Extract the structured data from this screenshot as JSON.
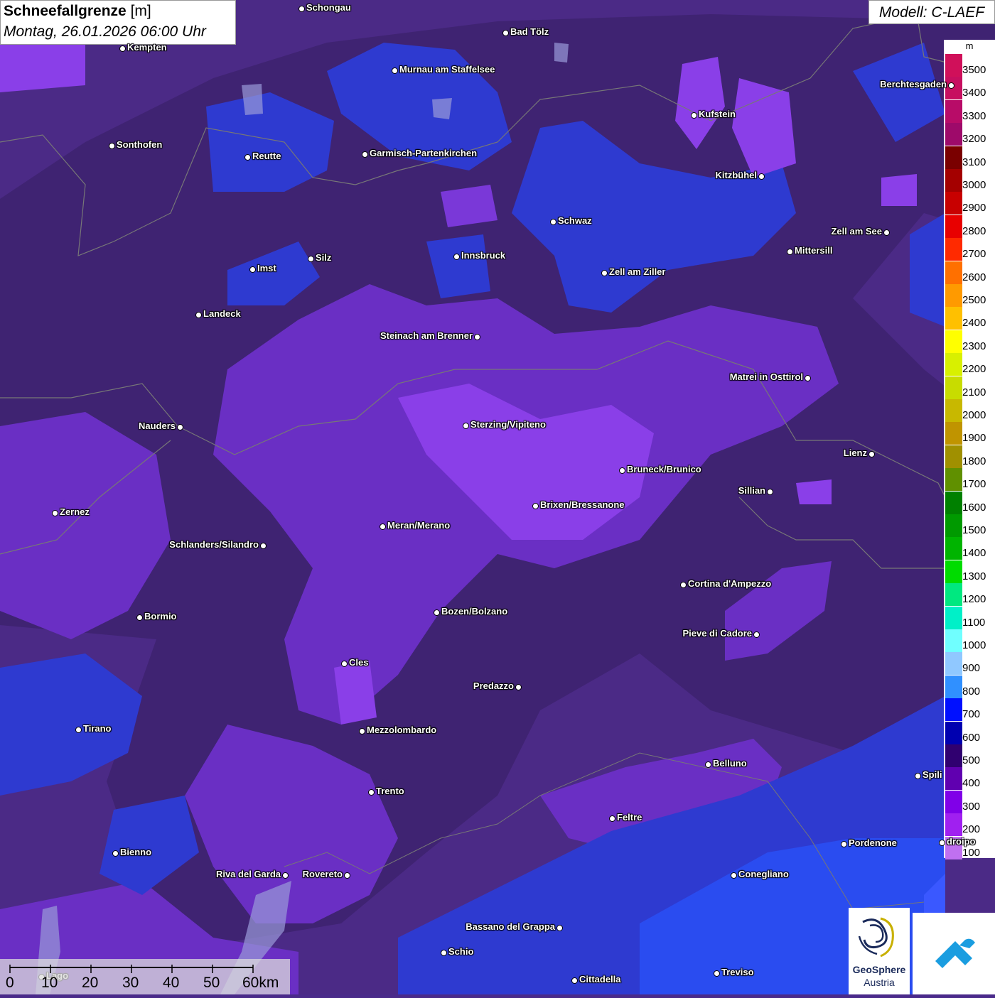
{
  "header": {
    "title_bold": "Schneefallgrenze",
    "title_unit": "[m]",
    "datetime": "Montag, 26.01.2026 06:00 Uhr",
    "model": "Modell: C-LAEF"
  },
  "legend": {
    "unit": "m",
    "entries": [
      {
        "label": "3500",
        "color": "#d0105a"
      },
      {
        "label": "3400",
        "color": "#c70f60"
      },
      {
        "label": "3300",
        "color": "#b80c68"
      },
      {
        "label": "3200",
        "color": "#9e0a6a"
      },
      {
        "label": "3100",
        "color": "#7a0000"
      },
      {
        "label": "3000",
        "color": "#a40000"
      },
      {
        "label": "2900",
        "color": "#c80000"
      },
      {
        "label": "2800",
        "color": "#e80000"
      },
      {
        "label": "2700",
        "color": "#ff2a00"
      },
      {
        "label": "2600",
        "color": "#ff7000"
      },
      {
        "label": "2500",
        "color": "#ff9a00"
      },
      {
        "label": "2400",
        "color": "#ffc000"
      },
      {
        "label": "2300",
        "color": "#ffff00"
      },
      {
        "label": "2200",
        "color": "#d8f000"
      },
      {
        "label": "2100",
        "color": "#c8dc00"
      },
      {
        "label": "2000",
        "color": "#c8b800"
      },
      {
        "label": "1900",
        "color": "#c09400"
      },
      {
        "label": "1800",
        "color": "#a09000"
      },
      {
        "label": "1700",
        "color": "#609000"
      },
      {
        "label": "1600",
        "color": "#008000"
      },
      {
        "label": "1500",
        "color": "#009a00"
      },
      {
        "label": "1400",
        "color": "#00b400"
      },
      {
        "label": "1300",
        "color": "#00dc00"
      },
      {
        "label": "1200",
        "color": "#00e880"
      },
      {
        "label": "1100",
        "color": "#00f0c8"
      },
      {
        "label": "1000",
        "color": "#70ffff"
      },
      {
        "label": "900",
        "color": "#90c8ff"
      },
      {
        "label": "800",
        "color": "#3090ff"
      },
      {
        "label": "700",
        "color": "#0010ff"
      },
      {
        "label": "600",
        "color": "#0000b0"
      },
      {
        "label": "500",
        "color": "#300070"
      },
      {
        "label": "400",
        "color": "#6000b0"
      },
      {
        "label": "300",
        "color": "#8000e8"
      },
      {
        "label": "200",
        "color": "#a020f0"
      },
      {
        "label": "100",
        "color": "#c070f0"
      }
    ]
  },
  "cities": [
    "Schongau",
    "Bad Tölz",
    "Kempten",
    "Murnau am Staffelsee",
    "Kufstein",
    "Berchtesgaden",
    "Sonthofen",
    "Reutte",
    "Garmisch-Partenkirchen",
    "Kitzbühel",
    "Schwaz",
    "Zell am See",
    "Mittersill",
    "Imst",
    "Silz",
    "Innsbruck",
    "Zell am Ziller",
    "Landeck",
    "Steinach am Brenner",
    "Matrei in Osttirol",
    "Nauders",
    "Sterzing/Vipiteno",
    "Lienz",
    "Bruneck/Brunico",
    "Sillian",
    "Brixen/Bressanone",
    "Zernez",
    "Meran/Merano",
    "Schlanders/Silandro",
    "Cortina d'Ampezzo",
    "Bormio",
    "Bozen/Bolzano",
    "Pieve di Cadore",
    "Cles",
    "Predazzo",
    "Tirano",
    "Mezzolombardo",
    "Belluno",
    "Spili",
    "Trento",
    "Feltre",
    "Pordenone",
    "Bienno",
    "Riva del Garda",
    "Rovereto",
    "Conegliano",
    "Bassano del Grappa",
    "Schio",
    "Treviso",
    "Cittadella",
    "droipo",
    "Lago"
  ],
  "scalebar": {
    "labels": [
      "0",
      "10",
      "20",
      "30",
      "40",
      "50",
      "60km"
    ]
  },
  "logos": {
    "geosphere_line1": "GeoSphere",
    "geosphere_line2": "Austria"
  }
}
